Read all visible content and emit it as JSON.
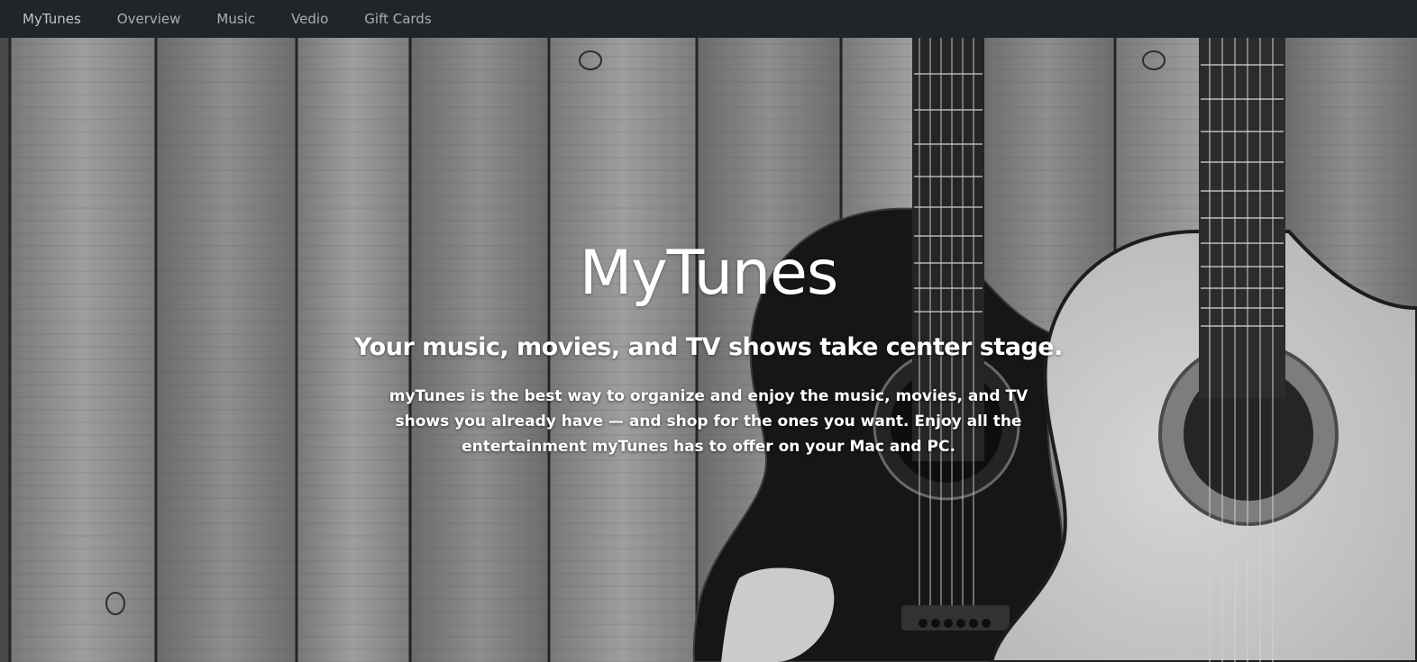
{
  "nav": {
    "items": [
      {
        "label": "MyTunes"
      },
      {
        "label": "Overview"
      },
      {
        "label": "Music"
      },
      {
        "label": "Vedio"
      },
      {
        "label": "Gift Cards"
      }
    ]
  },
  "hero": {
    "background_image": "wooden-planks-with-two-acoustic-guitars",
    "title": "MyTunes",
    "subtitle": "Your music, movies, and TV shows take center stage.",
    "description": "myTunes is the best way to organize and enjoy the music, movies, and TV shows you already have — and shop for the ones you want. Enjoy all the entertainment myTunes has to offer on your Mac and PC."
  },
  "colors": {
    "navbar_bg": "#212529",
    "nav_text": "#a0a3a6",
    "hero_text": "#ffffff"
  }
}
